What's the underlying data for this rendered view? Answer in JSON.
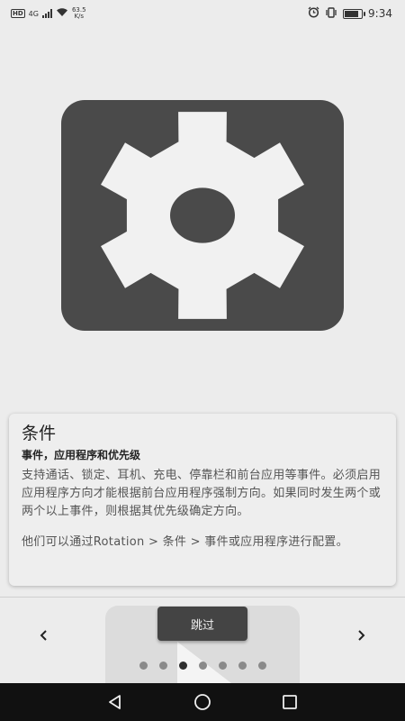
{
  "status_bar": {
    "network_badge": "HD",
    "network_type": "4G",
    "speed_value": "63.5",
    "speed_unit": "K/s",
    "time": "9:34",
    "battery_level": 0.85,
    "icons": [
      "hd-badge-icon",
      "signal-icon",
      "wifi-icon",
      "alarm-icon",
      "vibrate-icon",
      "battery-icon"
    ]
  },
  "hero": {
    "icon": "gear-icon",
    "background_color": "#4a4a4a",
    "gear_color": "#f1f1f1"
  },
  "card": {
    "title": "条件",
    "subtitle": "事件，应用程序和优先级",
    "body": "支持通话、锁定、耳机、充电、停靠栏和前台应用等事件。必须启用应用程序方向才能根据前台应用程序强制方向。如果同时发生两个或两个以上事件，则根据其优先级确定方向。",
    "note": "他们可以通过Rotation > 条件 > 事件或应用程序进行配置。"
  },
  "navigation": {
    "prev_icon": "chevron-left-icon",
    "next_icon": "chevron-right-icon",
    "skip_label": "跳过",
    "page_count": 7,
    "active_page": 3
  },
  "system_nav": {
    "icons": [
      "back-icon",
      "home-icon",
      "recents-icon"
    ]
  }
}
